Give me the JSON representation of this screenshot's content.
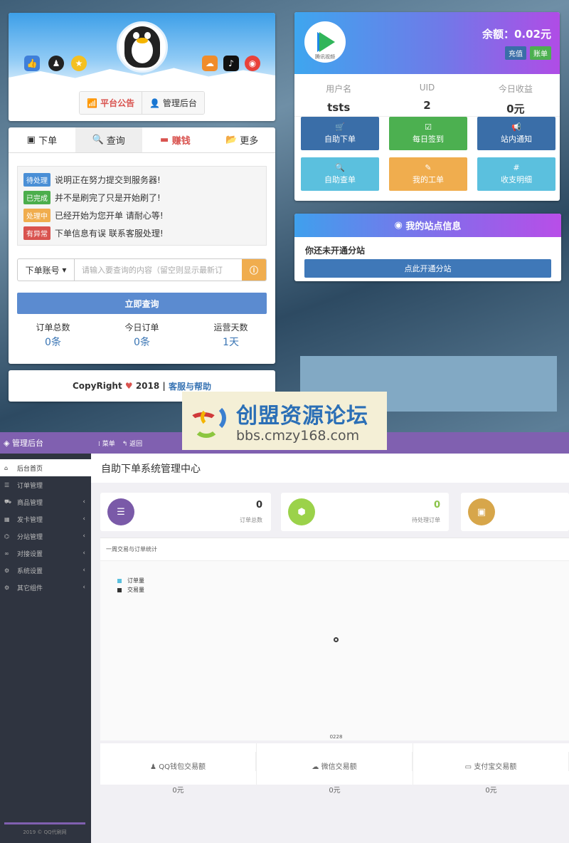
{
  "profile": {
    "left_icons": [
      "thumb-up-icon",
      "qq-icon",
      "star-icon"
    ],
    "right_icons": [
      "wechat-icon",
      "tiktok-icon",
      "weibo-icon"
    ],
    "announce_btn": "平台公告",
    "admin_btn": "管理后台"
  },
  "query": {
    "tabs": [
      "下单",
      "查询",
      "赚钱",
      "更多"
    ],
    "statuses": [
      {
        "badge": "待处理",
        "text": "说明正在努力提交到服务器!",
        "color": "#4a8fd6"
      },
      {
        "badge": "已完成",
        "text": "并不是刷完了只是开始刷了!",
        "color": "#4cae4c"
      },
      {
        "badge": "处理中",
        "text": "已经开始为您开单 请耐心等!",
        "color": "#f0ad4e"
      },
      {
        "badge": "有异常",
        "text": "下单信息有误 联系客服处理!",
        "color": "#d9534f"
      }
    ],
    "select_label": "下单账号",
    "input_placeholder": "请输入要查询的内容（留空则显示最新订",
    "submit": "立即查询",
    "stats": [
      {
        "label": "订单总数",
        "value": "0条"
      },
      {
        "label": "今日订单",
        "value": "0条"
      },
      {
        "label": "运营天数",
        "value": "1天"
      }
    ]
  },
  "footer": {
    "prefix": "CopyRight",
    "year": "2018 |",
    "link": "客服与帮助"
  },
  "user": {
    "logo_text": "腾讯视频",
    "balance": "余额：0.02元",
    "recharge": "充值",
    "ledger": "账单",
    "info": [
      {
        "label": "用户名",
        "value": "tsts"
      },
      {
        "label": "UID",
        "value": "2"
      },
      {
        "label": "今日收益",
        "value": "0元"
      }
    ],
    "tiles": [
      {
        "label": "自助下单",
        "icon": "cart-icon",
        "glyph": "🛒",
        "color": "#3a6ea8"
      },
      {
        "label": "每日签到",
        "icon": "checkbox-icon",
        "glyph": "☑",
        "color": "#4cb050"
      },
      {
        "label": "站内通知",
        "icon": "megaphone-icon",
        "glyph": "📢",
        "color": "#3a6ea8"
      },
      {
        "label": "自助查单",
        "icon": "search-icon",
        "glyph": "🔍",
        "color": "#5bc0de"
      },
      {
        "label": "我的工单",
        "icon": "edit-icon",
        "glyph": "✎",
        "color": "#f0ad4e"
      },
      {
        "label": "收支明细",
        "icon": "hash-icon",
        "glyph": "#",
        "color": "#5bc0de"
      }
    ]
  },
  "site": {
    "title": "我的站点信息",
    "text": "你还未开通分站",
    "button": "点此开通分站"
  },
  "watermark": {
    "title": "创盟资源论坛",
    "url": "bbs.cmzy168.com"
  },
  "admin": {
    "brand": "管理后台",
    "menu_btn": "菜单",
    "back_btn": "返回",
    "menu": [
      {
        "label": "后台首页",
        "icon": "home-icon",
        "glyph": "⌂",
        "arrow": false
      },
      {
        "label": "订单管理",
        "icon": "list-icon",
        "glyph": "☰",
        "arrow": false
      },
      {
        "label": "商品管理",
        "icon": "cart-icon",
        "glyph": "⛟",
        "arrow": true
      },
      {
        "label": "发卡管理",
        "icon": "grid-icon",
        "glyph": "▦",
        "arrow": true
      },
      {
        "label": "分站管理",
        "icon": "sitemap-icon",
        "glyph": "⌬",
        "arrow": true
      },
      {
        "label": "对接设置",
        "icon": "link-icon",
        "glyph": "∞",
        "arrow": true
      },
      {
        "label": "系统设置",
        "icon": "gear-icon",
        "glyph": "⚙",
        "arrow": true
      },
      {
        "label": "其它组件",
        "icon": "cogs-icon",
        "glyph": "⚙",
        "arrow": true
      }
    ],
    "footer": "2019 © QQ代刷网",
    "title": "自助下单系统管理中心",
    "cards": [
      {
        "value": "0",
        "label": "订单总数",
        "color": "#7a5aa8",
        "valcolor": "#333"
      },
      {
        "value": "0",
        "label": "待处理订单",
        "color": "#9bd24a",
        "valcolor": "#8bc34a"
      },
      {
        "value": "",
        "label": "",
        "color": "#d7a64a",
        "valcolor": "#333"
      }
    ],
    "chart_title": "一周交易与订单统计",
    "pay": [
      {
        "label": "QQ钱包交易额",
        "value": "0元",
        "icon": "qq-icon",
        "glyph": "♟"
      },
      {
        "label": "微信交易额",
        "value": "0元",
        "icon": "wechat-icon",
        "glyph": "☁"
      },
      {
        "label": "支付宝交易额",
        "value": "0元",
        "icon": "card-icon",
        "glyph": "▭"
      }
    ]
  },
  "chart_data": {
    "type": "line",
    "title": "一周交易与订单统计",
    "categories": [
      "0228"
    ],
    "series": [
      {
        "name": "订单量",
        "values": [
          0
        ],
        "color": "#5bc0de"
      },
      {
        "name": "交易量",
        "values": [
          0
        ],
        "color": "#333333"
      }
    ],
    "legend": "top-left",
    "grid": false
  }
}
